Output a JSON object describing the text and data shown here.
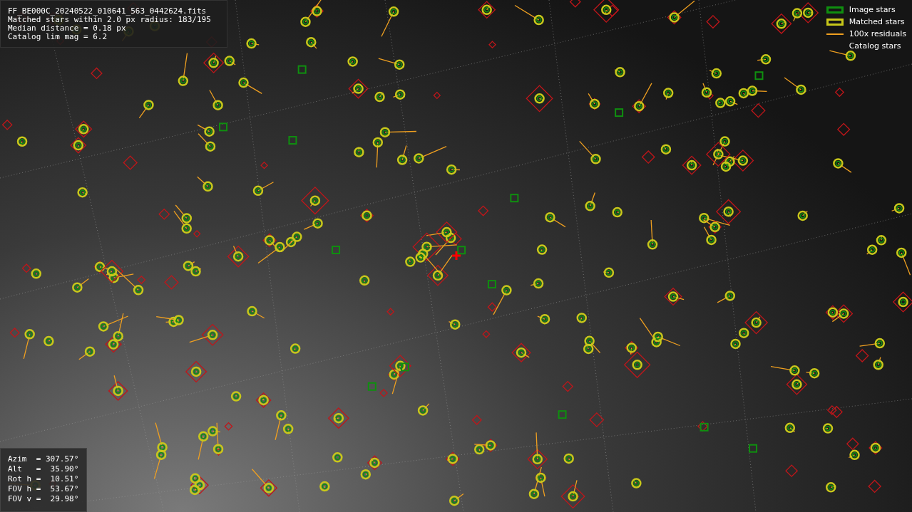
{
  "info": {
    "lines": [
      "FF_BE000C_20240522_010641_563_0442624.fits",
      "Matched stars within 2.0 px radius: 183/195",
      "Median distance = 0.18 px",
      "Catalog lim mag = 6.2"
    ]
  },
  "legend": [
    {
      "kind": "image",
      "label": "Image stars"
    },
    {
      "kind": "matched",
      "label": "Matched stars"
    },
    {
      "kind": "residual",
      "label": "100x residuals"
    },
    {
      "kind": "catalog",
      "label": "Catalog stars"
    }
  ],
  "pointing": {
    "lines": [
      "Azim  = 307.57°",
      "Alt   =  35.90°",
      "Rot h =  10.51°",
      "FOV h =  53.67°",
      "FOV v =  29.98°"
    ]
  }
}
